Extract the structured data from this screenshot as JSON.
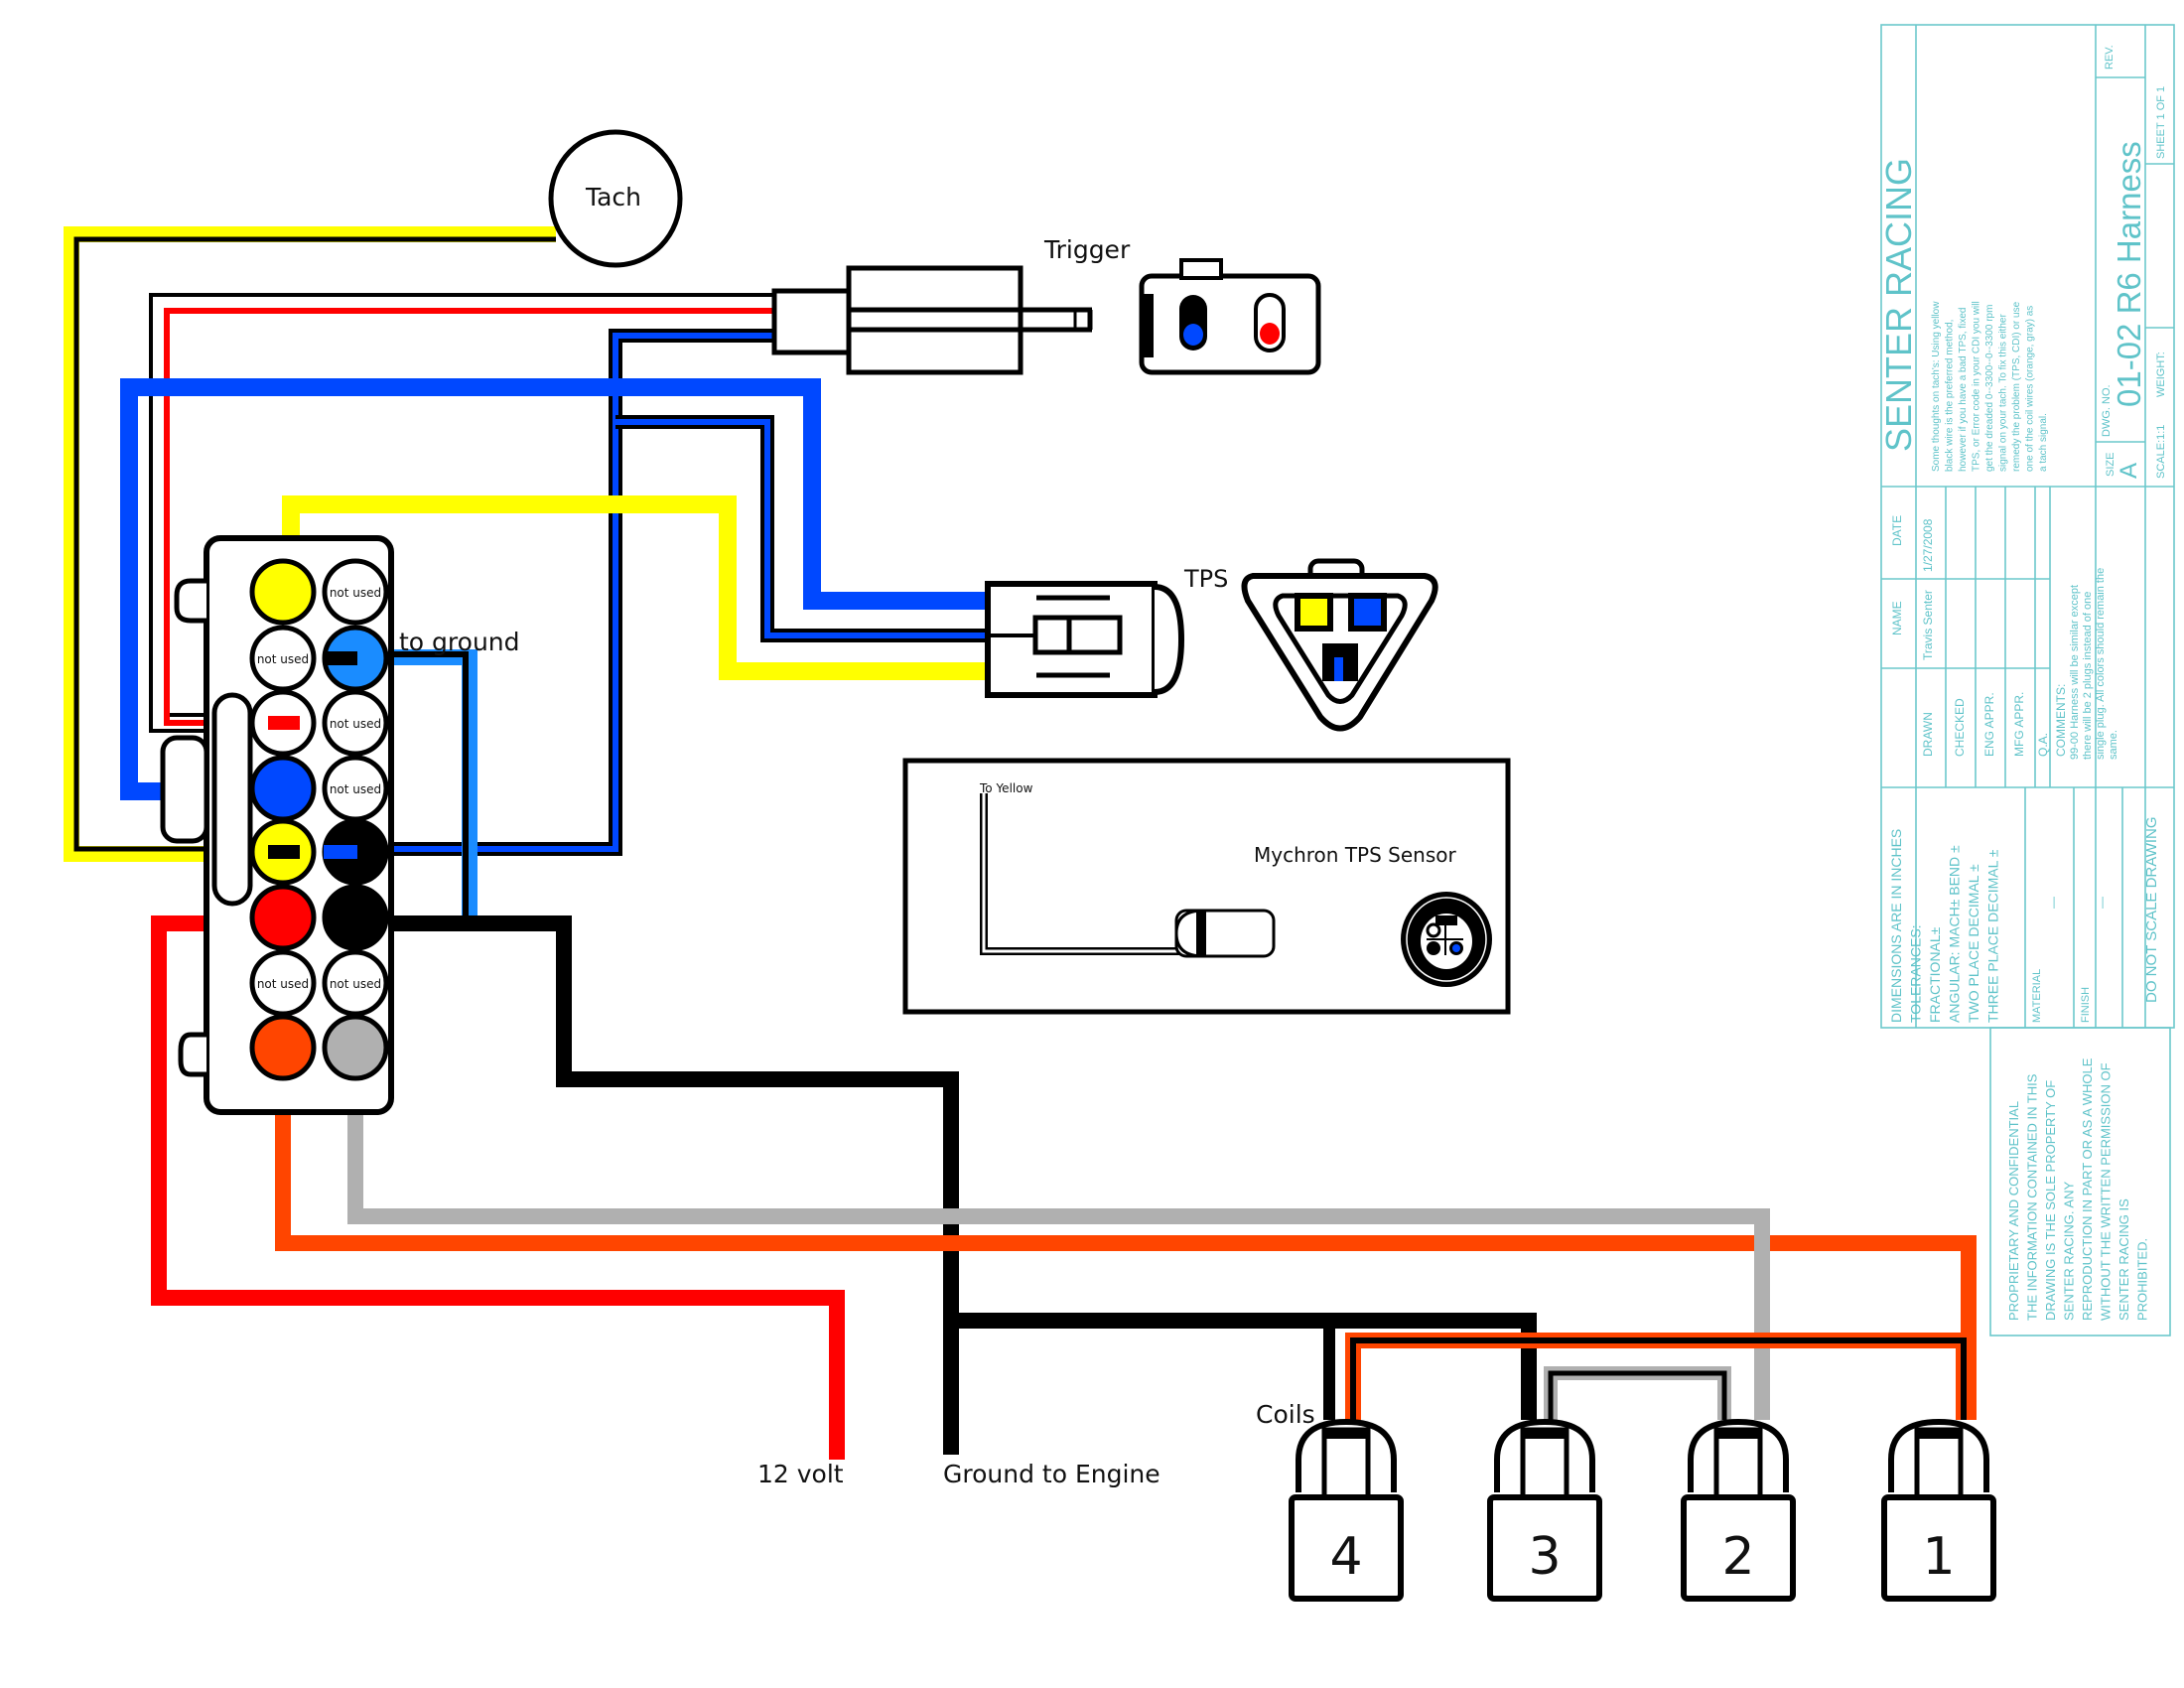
{
  "title_block": {
    "company": "SENTER RACING",
    "notes": [
      "Some thoughts on tach's: Using yellow",
      "black wire is the preferred method,",
      "however if you have a bad TPS, fixed",
      "TPS, or Error code in your CDI you will",
      "get the dreaded 0--3300--0--3300 rpm",
      "signal on your tach. To fix this either",
      "remedy the problem (TPS, CDI) or use",
      "one of the coil wires (orange, gray) as",
      "a tach signal."
    ],
    "size_label": "SIZE",
    "size_value": "A",
    "dwg_no_label": "DWG. NO.",
    "dwg_no_value": "01-02 R6 Harness",
    "rev_label": "REV.",
    "scale_label": "SCALE:1:1",
    "weight_label": "WEIGHT:",
    "sheet_label": "SHEET 1 OF 1",
    "name_header": "NAME",
    "date_header": "DATE",
    "drawn_label": "DRAWN",
    "drawn_name": "Travis Senter",
    "drawn_date": "1/27/2008",
    "checked_label": "CHECKED",
    "eng_appr_label": "ENG APPR.",
    "mfg_appr_label": "MFG APPR.",
    "qa_label": "Q.A.",
    "comments_label": "COMMENTS:",
    "comments": [
      "99-00 Harness will be similar except",
      "there will be 2 plugs instead of one",
      "single plug. All colors should remain the",
      "same."
    ],
    "tolerances": [
      "DIMENSIONS ARE IN INCHES",
      "TOLERANCES:",
      "FRACTIONAL±",
      "ANGULAR: MACH±    BEND ±",
      "TWO PLACE DECIMAL    ±",
      "THREE PLACE DECIMAL  ±"
    ],
    "material_label": "MATERIAL",
    "material_value": "—",
    "finish_label": "FINISH",
    "finish_value": "—",
    "do_not_scale": "DO NOT SCALE DRAWING",
    "proprietary": [
      "PROPRIETARY AND CONFIDENTIAL",
      "THE INFORMATION CONTAINED IN THIS",
      "DRAWING IS THE SOLE PROPERTY OF",
      "SENTER RACING.  ANY",
      "REPRODUCTION IN PART OR AS A WHOLE",
      "WITHOUT THE WRITTEN PERMISSION OF",
      "SENTER RACING IS",
      "PROHIBITED."
    ]
  },
  "labels": {
    "tach": "Tach",
    "trigger": "Trigger",
    "tps": "TPS",
    "to_ground": "to ground",
    "mychron": "Mychron TPS Sensor",
    "to_yellow": "To Yellow",
    "coils": "Coils",
    "twelve_volt": "12 volt",
    "ground_to_engine": "Ground to Engine"
  },
  "colors": {
    "yellow": "#ffff00",
    "blue": "#0048ff",
    "light_blue": "#1a8cff",
    "red": "#ff0000",
    "orange": "#ff4500",
    "gray": "#b0b0b0",
    "black": "#000000",
    "title_block": "#5fc3c9"
  },
  "connector": {
    "not_used": "not used",
    "pins": [
      {
        "row": 1,
        "col": "left",
        "color": "yellow",
        "label": ""
      },
      {
        "row": 1,
        "col": "right",
        "color": "white",
        "label": "not used"
      },
      {
        "row": 2,
        "col": "left",
        "color": "white",
        "label": "not used"
      },
      {
        "row": 2,
        "col": "right",
        "color": "light_blue",
        "stripe": "black",
        "label": ""
      },
      {
        "row": 3,
        "col": "left",
        "color": "white",
        "stripe": "red",
        "label": ""
      },
      {
        "row": 3,
        "col": "right",
        "color": "white",
        "label": "not used"
      },
      {
        "row": 4,
        "col": "left",
        "color": "blue",
        "label": ""
      },
      {
        "row": 4,
        "col": "right",
        "color": "white",
        "label": "not used"
      },
      {
        "row": 5,
        "col": "left",
        "color": "yellow",
        "stripe": "black",
        "label": ""
      },
      {
        "row": 5,
        "col": "right",
        "color": "black",
        "stripe": "blue",
        "label": ""
      },
      {
        "row": 6,
        "col": "left",
        "color": "red",
        "label": ""
      },
      {
        "row": 6,
        "col": "right",
        "color": "black",
        "label": ""
      },
      {
        "row": 7,
        "col": "left",
        "color": "white",
        "label": "not used"
      },
      {
        "row": 7,
        "col": "right",
        "color": "white",
        "label": "not used"
      },
      {
        "row": 8,
        "col": "left",
        "color": "orange",
        "label": ""
      },
      {
        "row": 8,
        "col": "right",
        "color": "gray",
        "label": ""
      }
    ]
  },
  "coils": [
    "4",
    "3",
    "2",
    "1"
  ]
}
